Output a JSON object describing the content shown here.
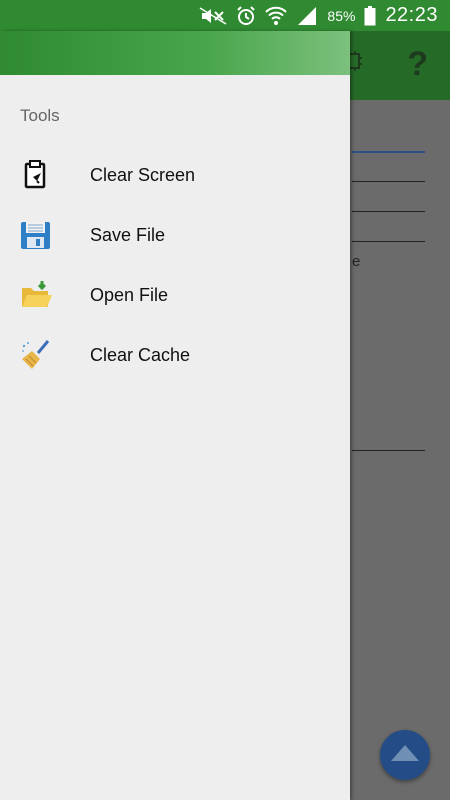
{
  "status_bar": {
    "battery_percent": "85%",
    "time": "22:23",
    "icons": [
      "mute-icon",
      "alarm-icon",
      "wifi-icon",
      "signal-icon",
      "battery-icon"
    ]
  },
  "drawer": {
    "section_title": "Tools",
    "items": [
      {
        "label": "Clear Screen",
        "icon": "clipboard-icon"
      },
      {
        "label": "Save File",
        "icon": "floppy-disk-icon"
      },
      {
        "label": "Open File",
        "icon": "open-folder-icon"
      },
      {
        "label": "Clear Cache",
        "icon": "broom-icon"
      }
    ]
  },
  "app": {
    "help_label": "?",
    "partial_text": "e"
  },
  "colors": {
    "status_bar": "#2f8a31",
    "toolbar": "#266a28",
    "drawer_bg": "#eeeeee",
    "fab": "#244c86"
  }
}
